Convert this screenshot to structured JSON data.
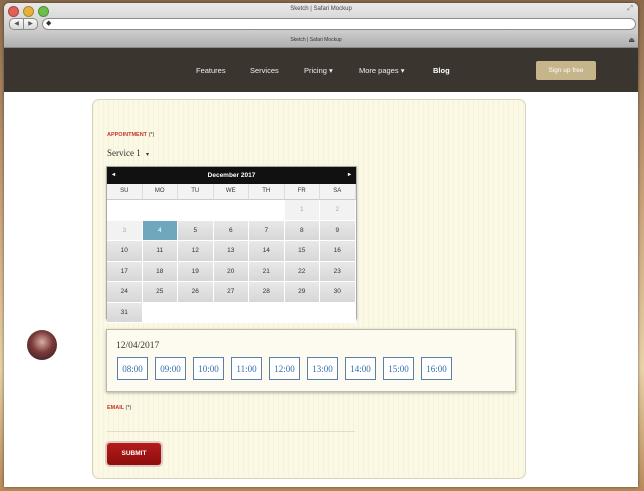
{
  "window": {
    "title": "Sketch | Safari Mockup",
    "resize_icon": "⤢",
    "back": "◀",
    "forward": "▶",
    "url_icon": "◆",
    "url": "",
    "tab_title": "Sketch | Safari Mockup",
    "tab_add": "⏏"
  },
  "nav": {
    "items": [
      {
        "label": "Features"
      },
      {
        "label": "Services"
      },
      {
        "label": "Pricing ▾"
      },
      {
        "label": "More pages ▾"
      },
      {
        "label": "Blog"
      }
    ],
    "signup": "Sign up free"
  },
  "form": {
    "appointment_label": "APPOINTMENT",
    "required_mark": "(*)",
    "service_value": "Service 1",
    "service_caret": "▾",
    "calendar": {
      "month": "December 2017",
      "prev": "◂",
      "next": "▸",
      "weekdays": [
        "SU",
        "MO",
        "TU",
        "WE",
        "TH",
        "FR",
        "SA"
      ],
      "rows": [
        [
          "",
          "",
          "",
          "",
          "",
          "1",
          "2"
        ],
        [
          "3",
          "4",
          "5",
          "6",
          "7",
          "8",
          "9"
        ],
        [
          "10",
          "11",
          "12",
          "13",
          "14",
          "15",
          "16"
        ],
        [
          "17",
          "18",
          "19",
          "20",
          "21",
          "22",
          "23"
        ],
        [
          "24",
          "25",
          "26",
          "27",
          "28",
          "29",
          "30"
        ],
        [
          "31",
          "",
          "",
          "",
          "",
          "",
          ""
        ]
      ],
      "selected": "4"
    },
    "selected_date": "12/04/2017",
    "time_slots": [
      "08:00",
      "09:00",
      "10:00",
      "11:00",
      "12:00",
      "13:00",
      "14:00",
      "15:00",
      "16:00"
    ],
    "email_label": "EMAIL",
    "email_value": "",
    "submit_label": "SUBMIT"
  },
  "colors": {
    "accent_red": "#c0392b",
    "nav_bg": "#3b3530",
    "signup_bg": "#c6b58a",
    "selected_day": "#6fa8be",
    "slot_text": "#2f6cae"
  }
}
